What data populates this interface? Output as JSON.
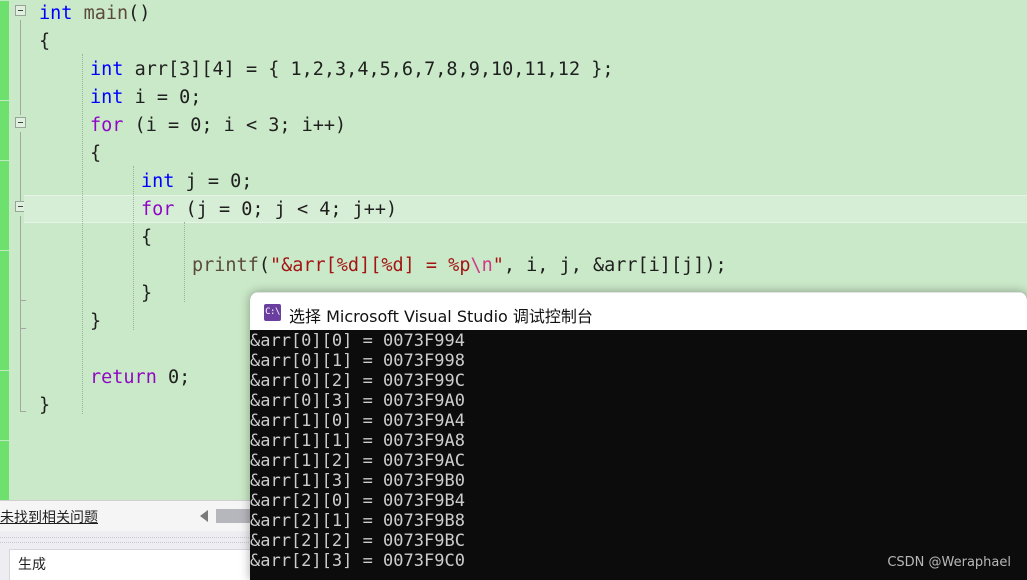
{
  "editor": {
    "background_color": "#cae9c8",
    "change_bar_color": "#6ee06e",
    "current_line_number": 8,
    "code_lines": [
      {
        "indent": 0,
        "tokens": [
          {
            "t": "int ",
            "c": "kw"
          },
          {
            "t": "main",
            "c": "fn"
          },
          {
            "t": "()",
            "c": "pln"
          }
        ]
      },
      {
        "indent": 0,
        "tokens": [
          {
            "t": "{",
            "c": "pln"
          }
        ]
      },
      {
        "indent": 1,
        "tokens": [
          {
            "t": "int ",
            "c": "kw"
          },
          {
            "t": "arr[3][4] = { 1,2,3,4,5,6,7,8,9,10,11,12 };",
            "c": "pln"
          }
        ]
      },
      {
        "indent": 1,
        "tokens": [
          {
            "t": "int ",
            "c": "kw"
          },
          {
            "t": "i = 0;",
            "c": "pln"
          }
        ]
      },
      {
        "indent": 1,
        "tokens": [
          {
            "t": "for",
            "c": "kwc"
          },
          {
            "t": " (i = 0; i < 3; i++)",
            "c": "pln"
          }
        ]
      },
      {
        "indent": 1,
        "tokens": [
          {
            "t": "{",
            "c": "pln"
          }
        ]
      },
      {
        "indent": 2,
        "tokens": [
          {
            "t": "int ",
            "c": "kw"
          },
          {
            "t": "j = 0;",
            "c": "pln"
          }
        ]
      },
      {
        "indent": 2,
        "tokens": [
          {
            "t": "for",
            "c": "kwc"
          },
          {
            "t": " (j = 0; j < 4; j++)",
            "c": "pln"
          }
        ]
      },
      {
        "indent": 2,
        "tokens": [
          {
            "t": "{",
            "c": "pln"
          }
        ]
      },
      {
        "indent": 3,
        "tokens": [
          {
            "t": "printf",
            "c": "fn"
          },
          {
            "t": "(",
            "c": "pln"
          },
          {
            "t": "\"&arr[%d][%d] = %p",
            "c": "str"
          },
          {
            "t": "\\n",
            "c": "esc"
          },
          {
            "t": "\"",
            "c": "str"
          },
          {
            "t": ", i, j, &arr[i][j]);",
            "c": "pln"
          }
        ]
      },
      {
        "indent": 2,
        "tokens": [
          {
            "t": "}",
            "c": "pln"
          }
        ]
      },
      {
        "indent": 1,
        "tokens": [
          {
            "t": "}",
            "c": "pln"
          }
        ]
      },
      {
        "indent": 0,
        "tokens": [
          {
            "t": "",
            "c": "pln"
          }
        ]
      },
      {
        "indent": 1,
        "tokens": [
          {
            "t": "return",
            "c": "kwc"
          },
          {
            "t": " 0;",
            "c": "pln"
          }
        ]
      },
      {
        "indent": 0,
        "tokens": [
          {
            "t": "}",
            "c": "pln"
          }
        ]
      }
    ]
  },
  "status_bar": {
    "message": "未找到相关问题",
    "scroll_left_icon": "triangle-left-icon"
  },
  "lower_pane": {
    "label": "生成"
  },
  "console": {
    "icon_name": "cmd-console-icon",
    "icon_glyph": "C:\\",
    "title": "选择 Microsoft Visual Studio 调试控制台",
    "background_color": "#0c0c0c",
    "text_color": "#cccccc",
    "lines": [
      "&arr[0][0] = 0073F994",
      "&arr[0][1] = 0073F998",
      "&arr[0][2] = 0073F99C",
      "&arr[0][3] = 0073F9A0",
      "&arr[1][0] = 0073F9A4",
      "&arr[1][1] = 0073F9A8",
      "&arr[1][2] = 0073F9AC",
      "&arr[1][3] = 0073F9B0",
      "&arr[2][0] = 0073F9B4",
      "&arr[2][1] = 0073F9B8",
      "&arr[2][2] = 0073F9BC",
      "&arr[2][3] = 0073F9C0"
    ]
  },
  "watermark": {
    "text": "CSDN @Weraphael"
  }
}
